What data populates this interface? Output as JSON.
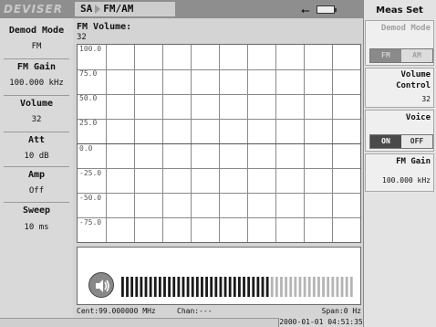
{
  "header": {
    "logo": "DEVISER",
    "mode_left": "SA",
    "mode_right": "FM/AM"
  },
  "sidebar": {
    "items": [
      {
        "label": "Demod Mode",
        "value": "FM"
      },
      {
        "label": "FM Gain",
        "value": "100.000 kHz"
      },
      {
        "label": "Volume",
        "value": "32"
      },
      {
        "label": "Att",
        "value": "10 dB"
      },
      {
        "label": "Amp",
        "value": "Off"
      },
      {
        "label": "Sweep",
        "value": "10 ms"
      }
    ]
  },
  "plot": {
    "title": "FM Volume:",
    "value": "32",
    "y_labels": [
      "100.0",
      "75.0",
      "50.0",
      "25.0",
      "0.0",
      "-25.0",
      "-50.0",
      "-75.0"
    ]
  },
  "volume_meter": {
    "level": 32,
    "max": 50
  },
  "status": {
    "center": "Cent:99.000000 MHz",
    "channel": "Chan:---",
    "span": "Span:0 Hz",
    "datetime": "2000-01-01 04:51:35"
  },
  "menu": {
    "title": "Meas Set",
    "demod_mode_label": "Demod Mode",
    "demod_fm": "FM",
    "demod_am": "AM",
    "volume_control_line1": "Volume",
    "volume_control_line2": "Control",
    "volume_control_value": "32",
    "voice_label": "Voice",
    "voice_on": "ON",
    "voice_off": "OFF",
    "fm_gain_label": "FM Gain",
    "fm_gain_value": "100.000 kHz"
  }
}
